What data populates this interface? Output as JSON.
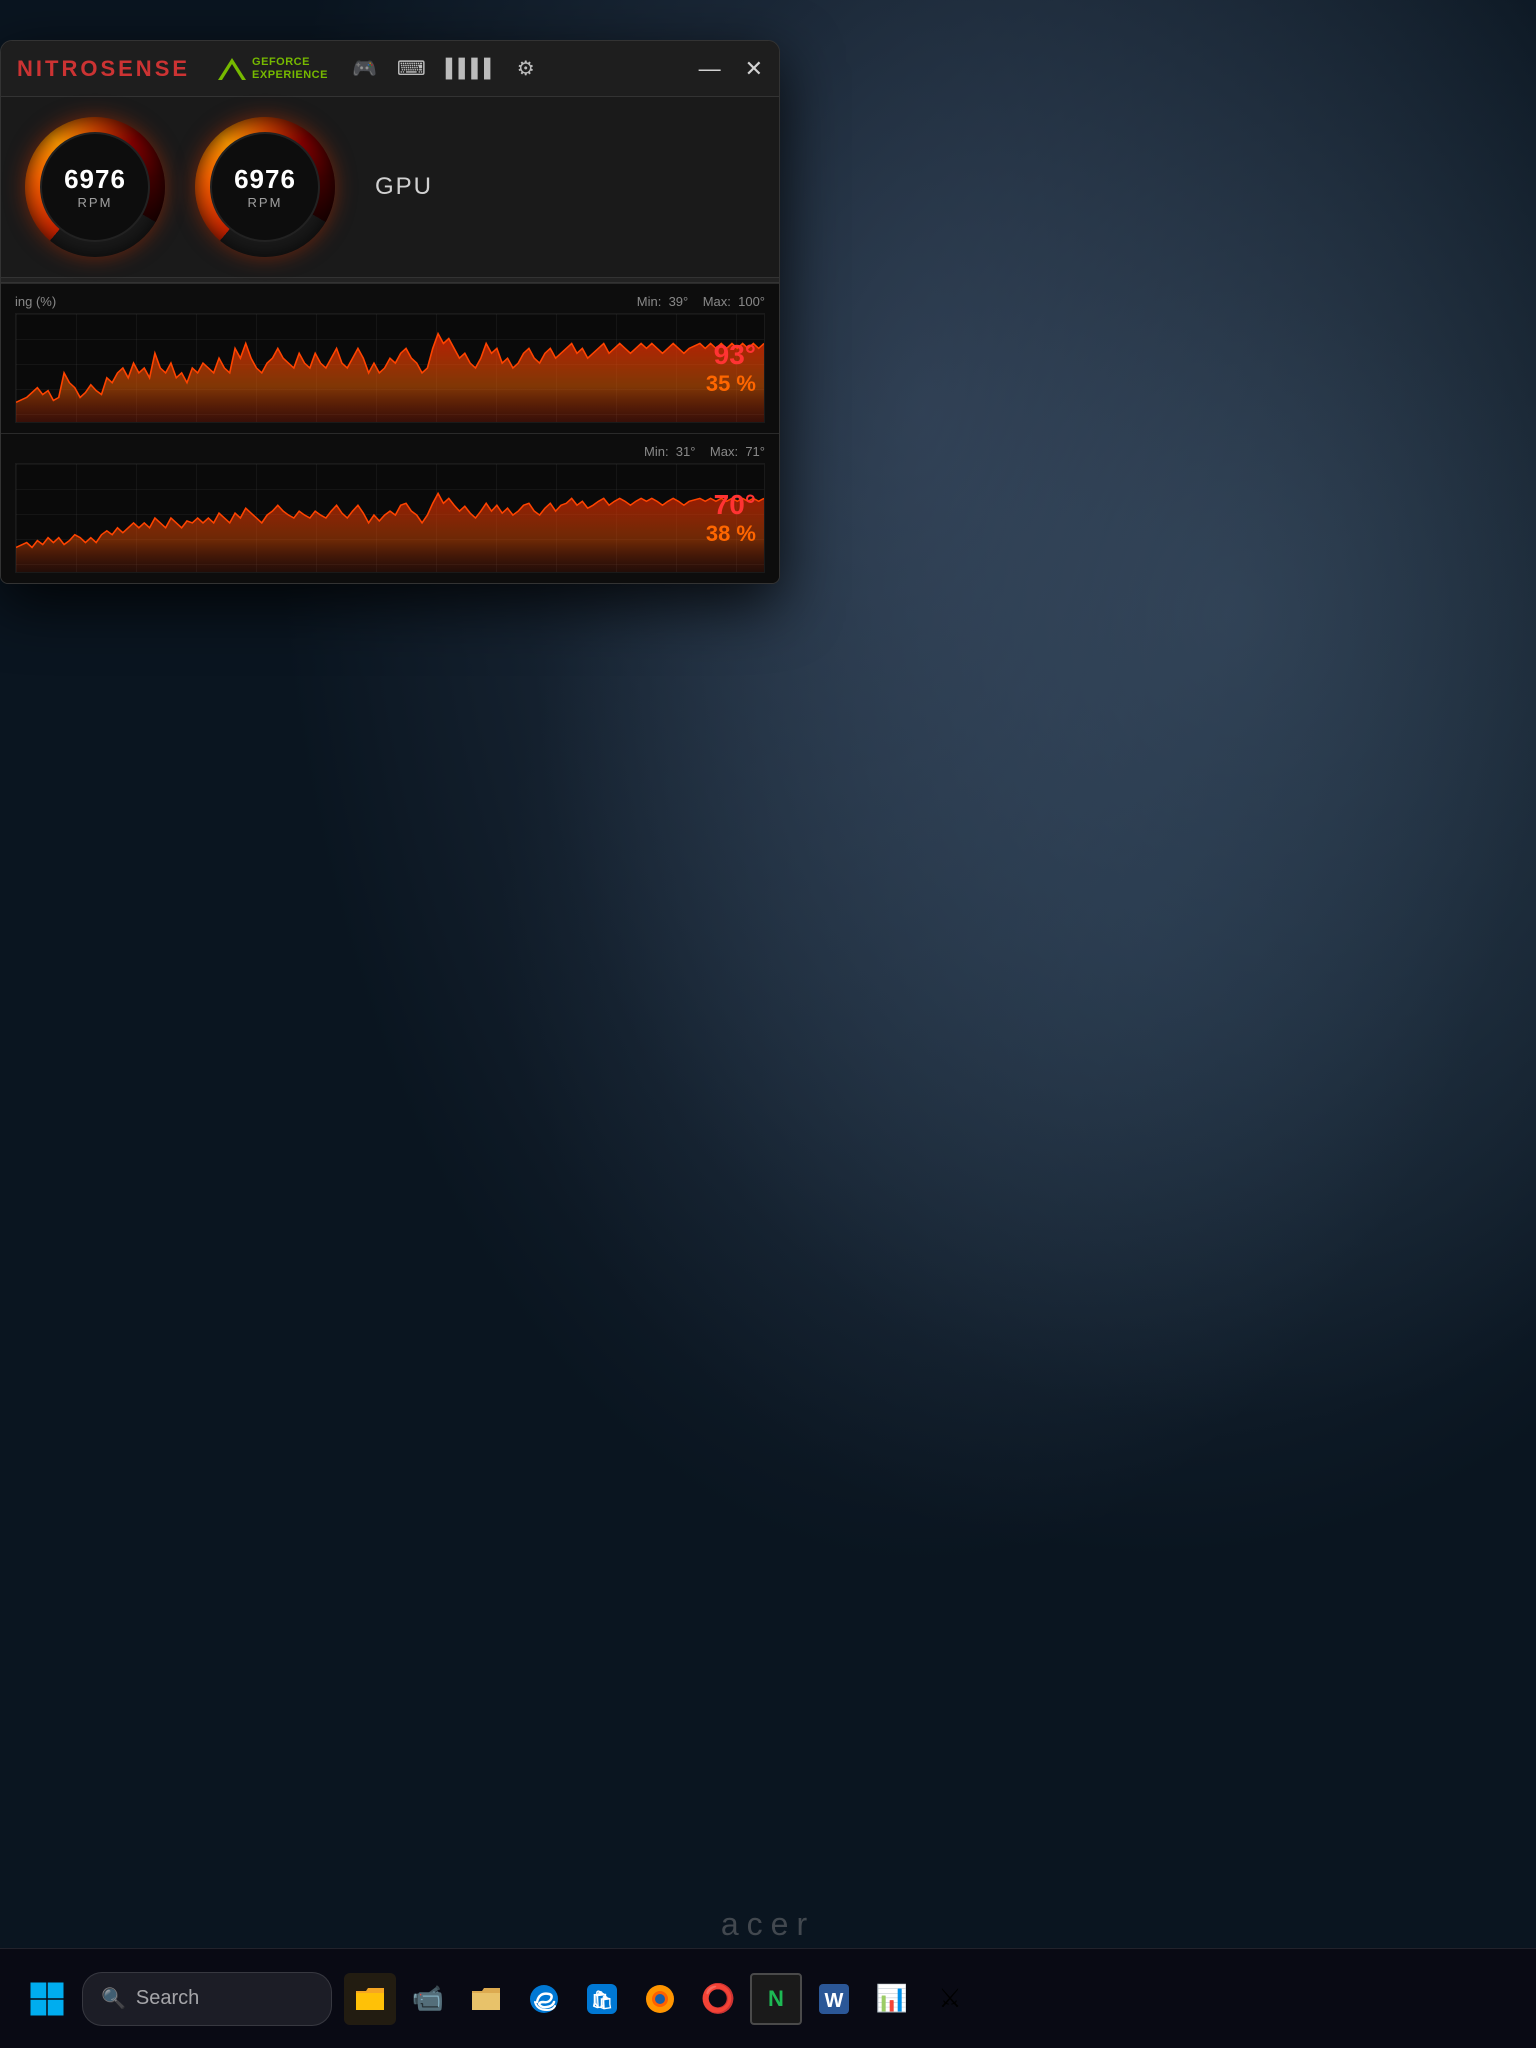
{
  "app": {
    "title_prefix": "NITRO",
    "title_suffix": "SENSE"
  },
  "geforce": {
    "logo": "◀",
    "line1": "GEFORCE",
    "line2": "EXPERIENCE"
  },
  "titlebar": {
    "icons": [
      "🎮",
      "⌨",
      "〰",
      "⚙"
    ],
    "minimize": "—",
    "close": "✕"
  },
  "fans": [
    {
      "value": "6976",
      "unit": "RPM"
    },
    {
      "value": "6976",
      "unit": "RPM"
    }
  ],
  "gpu_label": "GPU",
  "graphs": [
    {
      "label": "ing (%)",
      "min": "39°",
      "max": "100°",
      "min_label": "Min:",
      "max_label": "Max:",
      "temp": "93°",
      "percent": "35 %"
    },
    {
      "label": "",
      "min": "31°",
      "max": "71°",
      "min_label": "Min:",
      "max_label": "Max:",
      "temp": "70°",
      "percent": "38 %"
    }
  ],
  "taskbar": {
    "search_text": "Search",
    "icons": [
      "🖥",
      "📹",
      "📁",
      "🌐",
      "🛒",
      "🦊",
      "⭕",
      "N",
      "W",
      "📊",
      "⚔"
    ]
  },
  "acer_brand": "acer"
}
